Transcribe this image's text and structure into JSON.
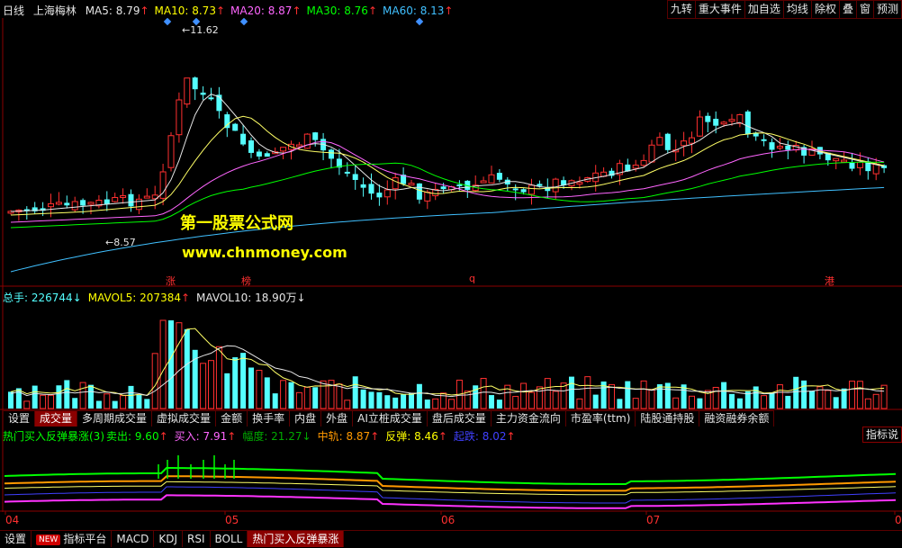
{
  "header": {
    "period": "日线",
    "stock_name": "上海梅林",
    "ma": [
      {
        "label": "MA5:",
        "value": "8.79",
        "dir": "up",
        "color": "#e6e6e6"
      },
      {
        "label": "MA10:",
        "value": "8.73",
        "dir": "up",
        "color": "#ffff00"
      },
      {
        "label": "MA20:",
        "value": "8.87",
        "dir": "up",
        "color": "#ff66ff"
      },
      {
        "label": "MA30:",
        "value": "8.76",
        "dir": "up",
        "color": "#00ff00"
      },
      {
        "label": "MA60:",
        "value": "8.13",
        "dir": "up",
        "color": "#40c0ff"
      }
    ],
    "buttons": [
      "九转",
      "重大事件",
      "加自选",
      "均线",
      "除权",
      "叠",
      "窗",
      "预测"
    ]
  },
  "price_chart": {
    "high_label": "11.62",
    "low_label": "8.57",
    "watermark_name": "第一股票公式网",
    "watermark_url": "www.chnmoney.com",
    "markers": [
      "涨",
      "榜",
      "q",
      "港"
    ],
    "colors": {
      "up": "#ff3030",
      "down": "#54ffff",
      "ma5": "#e6e6e6",
      "ma10": "#ffff66",
      "ma20": "#ff66ff",
      "ma30": "#00ff00",
      "ma60": "#40c0ff"
    }
  },
  "volume_panel": {
    "legend": [
      {
        "label": "总手:",
        "value": "226744",
        "dir": "down",
        "color": "#54ffff"
      },
      {
        "label": "MAVOL5:",
        "value": "207384",
        "dir": "up",
        "color": "#ffff00"
      },
      {
        "label": "MAVOL10:",
        "value": "18.90万",
        "dir": "down",
        "color": "#e6e6e6"
      }
    ]
  },
  "indicator_tabs": [
    "设置",
    "成交量",
    "多周期成交量",
    "虚拟成交量",
    "金额",
    "换手率",
    "内盘",
    "外盘",
    "AI立桩成交量",
    "盘后成交量",
    "主力资金流向",
    "市盈率(ttm)",
    "陆股通持股",
    "融资融券余额"
  ],
  "indicator_tabs_active": 1,
  "indicator_panel": {
    "title": "热门买入反弹暴涨(3)",
    "legend": [
      {
        "label": "卖出:",
        "value": "9.60",
        "dir": "up",
        "color": "#00ff00"
      },
      {
        "label": "买入:",
        "value": "7.91",
        "dir": "up",
        "color": "#ff66ff"
      },
      {
        "label": "幅度:",
        "value": "21.27",
        "dir": "down",
        "color": "#00aa00"
      },
      {
        "label": "中轨:",
        "value": "8.87",
        "dir": "up",
        "color": "#ff9900"
      },
      {
        "label": "反弹:",
        "value": "8.46",
        "dir": "up",
        "color": "#ffff00"
      },
      {
        "label": "起跌:",
        "value": "8.02",
        "dir": "up",
        "color": "#4040ff"
      }
    ],
    "right_button": "指标说"
  },
  "x_axis": [
    "04",
    "05",
    "06",
    "07",
    "0"
  ],
  "bottom_tabs": [
    {
      "label": "设置",
      "badge": ""
    },
    {
      "label": "指标平台",
      "badge": "NEW"
    },
    {
      "label": "MACD",
      "badge": ""
    },
    {
      "label": "KDJ",
      "badge": ""
    },
    {
      "label": "RSI",
      "badge": ""
    },
    {
      "label": "BOLL",
      "badge": ""
    },
    {
      "label": "热门买入反弹暴涨",
      "badge": ""
    }
  ],
  "bottom_tabs_active": 6
}
